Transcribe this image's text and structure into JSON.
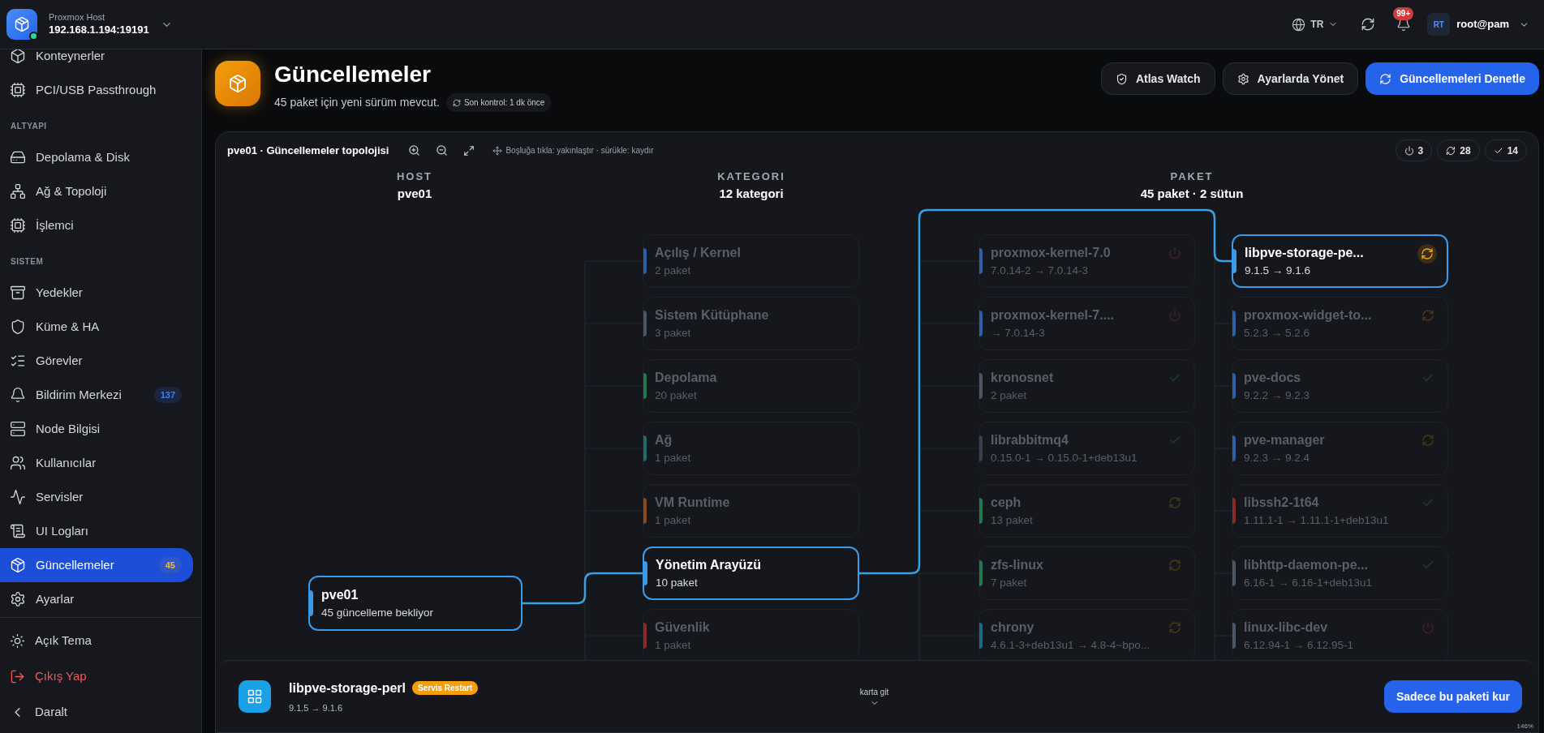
{
  "host": {
    "label": "Proxmox Host",
    "address": "192.168.1.194:19191",
    "online": true
  },
  "topbar": {
    "language": "TR",
    "notifications_badge": "99+",
    "avatar": "RT",
    "user": "root@pam"
  },
  "sidebar": {
    "groups": [
      {
        "items": [
          {
            "label": "Konteynerler",
            "selected": false
          },
          {
            "label": "PCI/USB Passthrough",
            "selected": false
          }
        ]
      },
      {
        "title": "ALTYAPI",
        "items": [
          {
            "label": "Depolama & Disk",
            "selected": false
          },
          {
            "label": "Ağ & Topoloji",
            "selected": false
          },
          {
            "label": "İşlemci",
            "selected": false
          }
        ]
      },
      {
        "title": "SISTEM",
        "items": [
          {
            "label": "Yedekler",
            "selected": false
          },
          {
            "label": "Küme & HA",
            "selected": false
          },
          {
            "label": "Görevler",
            "selected": false
          },
          {
            "label": "Bildirim Merkezi",
            "selected": false,
            "badge": {
              "text": "137",
              "kind": "info"
            }
          },
          {
            "label": "Node Bilgisi",
            "selected": false
          },
          {
            "label": "Kullanıcılar",
            "selected": false
          },
          {
            "label": "Servisler",
            "selected": false
          },
          {
            "label": "UI Logları",
            "selected": false
          },
          {
            "label": "Güncellemeler",
            "selected": true,
            "badge": {
              "text": "45",
              "kind": "warning"
            }
          },
          {
            "label": "Ayarlar",
            "selected": false
          }
        ]
      }
    ],
    "footer": [
      {
        "label": "Açık Tema",
        "kind": "normal"
      },
      {
        "label": "Çıkış Yap",
        "kind": "danger"
      },
      {
        "label": "Daralt",
        "kind": "normal"
      }
    ]
  },
  "page": {
    "title": "Güncellemeler",
    "subtitle": "45 paket için yeni sürüm mevcut.",
    "last_check": "Son kontrol: 1 dk önce",
    "actions": [
      {
        "label": "Atlas Watch",
        "kind": "secondary"
      },
      {
        "label": "Ayarlarda Yönet",
        "kind": "secondary"
      },
      {
        "label": "Güncellemeleri Denetle",
        "kind": "primary"
      }
    ]
  },
  "topology": {
    "title": "pve01 · Güncellemeler topolojisi",
    "hint": "Boşluğa tıkla: yakınlaştır · sürükle: kaydır",
    "counters": [
      {
        "kind": "restart",
        "count": "3"
      },
      {
        "kind": "update",
        "count": "28"
      },
      {
        "kind": "ok",
        "count": "14"
      }
    ],
    "columns": [
      {
        "heading": "HOST",
        "value": "pve01"
      },
      {
        "heading": "KATEGORI",
        "value": "12 kategori"
      },
      {
        "heading": "PAKET",
        "value": "45 paket · 2 sütun"
      }
    ],
    "host_node": {
      "name": "pve01",
      "sub": "45 güncelleme bekliyor",
      "selected": true,
      "color": "#3b9be8"
    },
    "categories": [
      {
        "name": "Açılış / Kernel",
        "sub": "2 paket",
        "color": "#2b5fa8",
        "selected": false
      },
      {
        "name": "Sistem Kütüphane",
        "sub": "3 paket",
        "color": "#4b5563",
        "selected": false
      },
      {
        "name": "Depolama",
        "sub": "20 paket",
        "color": "#1f7a4d",
        "selected": false
      },
      {
        "name": "Ağ",
        "sub": "1 paket",
        "color": "#1d6b6b",
        "selected": false
      },
      {
        "name": "VM Runtime",
        "sub": "1 paket",
        "color": "#8a4a1c",
        "selected": false
      },
      {
        "name": "Yönetim Arayüzü",
        "sub": "10 paket",
        "color": "#3b9be8",
        "selected": true
      },
      {
        "name": "Güvenlik",
        "sub": "1 paket",
        "color": "#8a2a2a",
        "selected": false
      }
    ],
    "package_columns": [
      {
        "items": [
          {
            "name": "proxmox-kernel-7.0",
            "sub": "7.0.14-2 → 7.0.14-3",
            "kind": "restart",
            "color": "#2b5fa8",
            "selected": false
          },
          {
            "name": "proxmox-kernel-7....",
            "sub": "→ 7.0.14-3",
            "kind": "restart",
            "color": "#2b5fa8",
            "selected": false
          },
          {
            "name": "kronosnet",
            "sub": "2 paket",
            "kind": "ok",
            "color": "#4b5563",
            "selected": false
          },
          {
            "name": "librabbitmq4",
            "sub": "0.15.0-1 → 0.15.0-1+deb13u1",
            "kind": "ok",
            "color": "#374151",
            "selected": false
          },
          {
            "name": "ceph",
            "sub": "13 paket",
            "kind": "update",
            "color": "#1f7a4d",
            "selected": false
          },
          {
            "name": "zfs-linux",
            "sub": "7 paket",
            "kind": "update",
            "color": "#1f7a4d",
            "selected": false
          },
          {
            "name": "chrony",
            "sub": "4.6.1-3+deb13u1 → 4.8-4~bpo...",
            "kind": "update",
            "color": "#1d6b8a",
            "selected": false
          }
        ]
      },
      {
        "items": [
          {
            "name": "libpve-storage-pe...",
            "sub": "9.1.5 → 9.1.6",
            "kind": "update",
            "color": "#3b9be8",
            "selected": true
          },
          {
            "name": "proxmox-widget-to...",
            "sub": "5.2.3 → 5.2.6",
            "kind": "update",
            "color": "#2b5fa8",
            "selected": false
          },
          {
            "name": "pve-docs",
            "sub": "9.2.2 → 9.2.3",
            "kind": "ok",
            "color": "#2b5fa8",
            "selected": false
          },
          {
            "name": "pve-manager",
            "sub": "9.2.3 → 9.2.4",
            "kind": "update",
            "color": "#2b5fa8",
            "selected": false
          },
          {
            "name": "libssh2-1t64",
            "sub": "1.11.1-1 → 1.11.1-1+deb13u1",
            "kind": "ok",
            "color": "#8a2a2a",
            "selected": false
          },
          {
            "name": "libhttp-daemon-pe...",
            "sub": "6.16-1 → 6.16-1+deb13u1",
            "kind": "ok",
            "color": "#4b5563",
            "selected": false
          },
          {
            "name": "linux-libc-dev",
            "sub": "6.12.94-1 → 6.12.95-1",
            "kind": "restart",
            "color": "#4b5563",
            "selected": false
          }
        ]
      }
    ]
  },
  "detail": {
    "name": "libpve-storage-perl",
    "badge": "Servis Restart",
    "version": "9.1.5 → 9.1.6",
    "goto": "karta git",
    "install": "Sadece bu paketi kur",
    "zoom": "146%"
  }
}
